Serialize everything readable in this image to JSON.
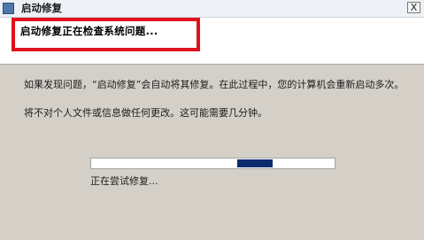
{
  "window": {
    "title": "启动修复",
    "app_icon": "repair-app-icon",
    "close_glyph": "X"
  },
  "header": {
    "heading": "启动修复正在检查系统问题..."
  },
  "content": {
    "paragraph_1": "如果发现问题，“启动修复”会自动将其修复。在此过程中，您的计算机会重新启动多次。",
    "paragraph_2": "将不对个人文件或信息做任何更改。这可能需要几分钟。"
  },
  "progress": {
    "status_text": "正在尝试修复...",
    "marquee_position": 0.7,
    "fill_color": "#0b2c6e"
  },
  "annotation": {
    "highlight_color": "#e0111d"
  }
}
